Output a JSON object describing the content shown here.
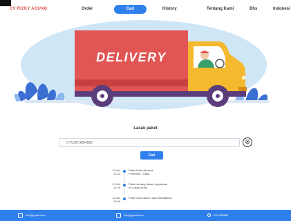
{
  "nav": {
    "brand": "CV RIZKY AGUNG",
    "items": [
      "Order",
      "Cari",
      "History",
      "Tentang Kami",
      "Bhs",
      "Indonesi"
    ]
  },
  "hero": {
    "truck_label": "DELIVERY"
  },
  "tracking": {
    "label": "Lacak paket",
    "input_value": "CTV3673854885",
    "clear_icon": "⊗",
    "button": "Cari"
  },
  "timeline": [
    {
      "date": "11 Mei\n12:31",
      "desc": "Paket telah diterima\nPenerima : Gaka"
    },
    {
      "date": "10 Mei\n12:35",
      "desc": "Paket sedang dalam perjalanan\nke Lokasi Anda"
    },
    {
      "date": "11 Mei\n13:00",
      "desc": "Paket telah dikirim dari SURABAYA"
    }
  ],
  "footer": {
    "email": "info@gmail.com",
    "mail": "info@gmail.com",
    "phone": "031-999881"
  },
  "colors": {
    "accent": "#2f80ed",
    "brand": "#d9534f",
    "truck_box": "#e15654",
    "truck_cab": "#f4b92e"
  }
}
